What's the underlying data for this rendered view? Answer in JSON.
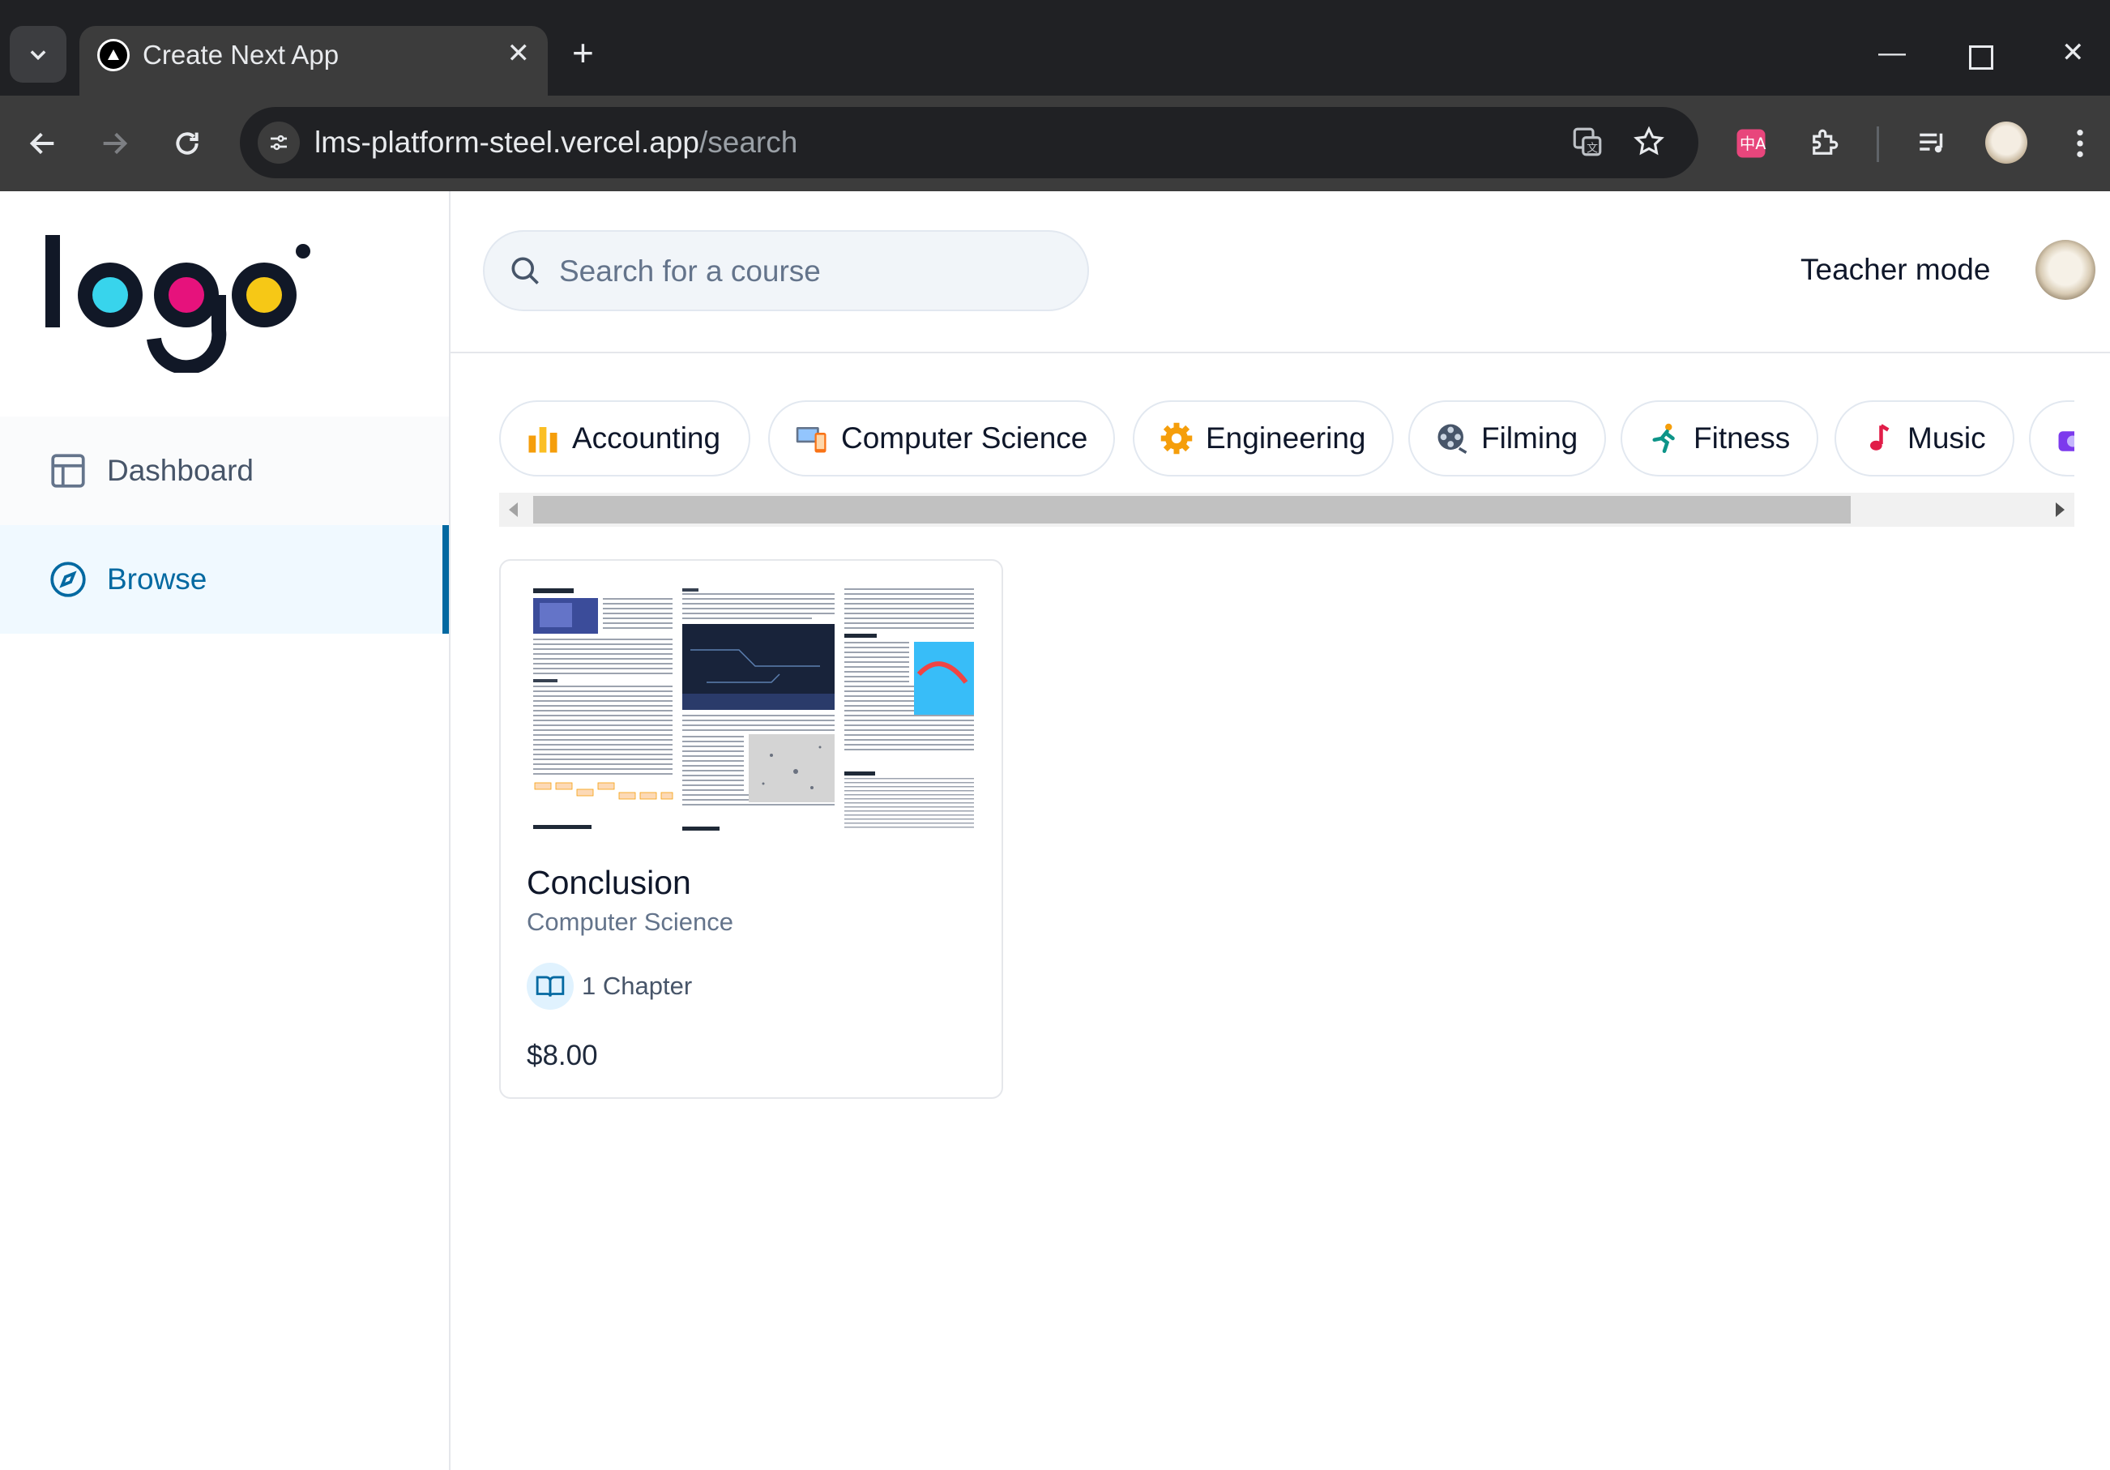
{
  "browser": {
    "tab_title": "Create Next App",
    "url_host": "lms-platform-steel.vercel.app",
    "url_path": "/search"
  },
  "sidebar": {
    "items": [
      {
        "label": "Dashboard",
        "icon": "layout-icon"
      },
      {
        "label": "Browse",
        "icon": "compass-icon",
        "active": true
      }
    ]
  },
  "header": {
    "search_placeholder": "Search for a course",
    "teacher_mode_label": "Teacher mode"
  },
  "categories": [
    {
      "label": "Accounting",
      "icon": "bar-chart-emoji"
    },
    {
      "label": "Computer Science",
      "icon": "computer-phone-emoji"
    },
    {
      "label": "Engineering",
      "icon": "gear-emoji"
    },
    {
      "label": "Filming",
      "icon": "film-reel-emoji"
    },
    {
      "label": "Fitness",
      "icon": "runner-emoji"
    },
    {
      "label": "Music",
      "icon": "music-note-emoji"
    }
  ],
  "courses": [
    {
      "title": "Conclusion",
      "category": "Computer Science",
      "chapters": "1 Chapter",
      "price": "$8.00"
    }
  ],
  "colors": {
    "accent": "#0369a1",
    "active_bg": "#f0f9ff"
  }
}
